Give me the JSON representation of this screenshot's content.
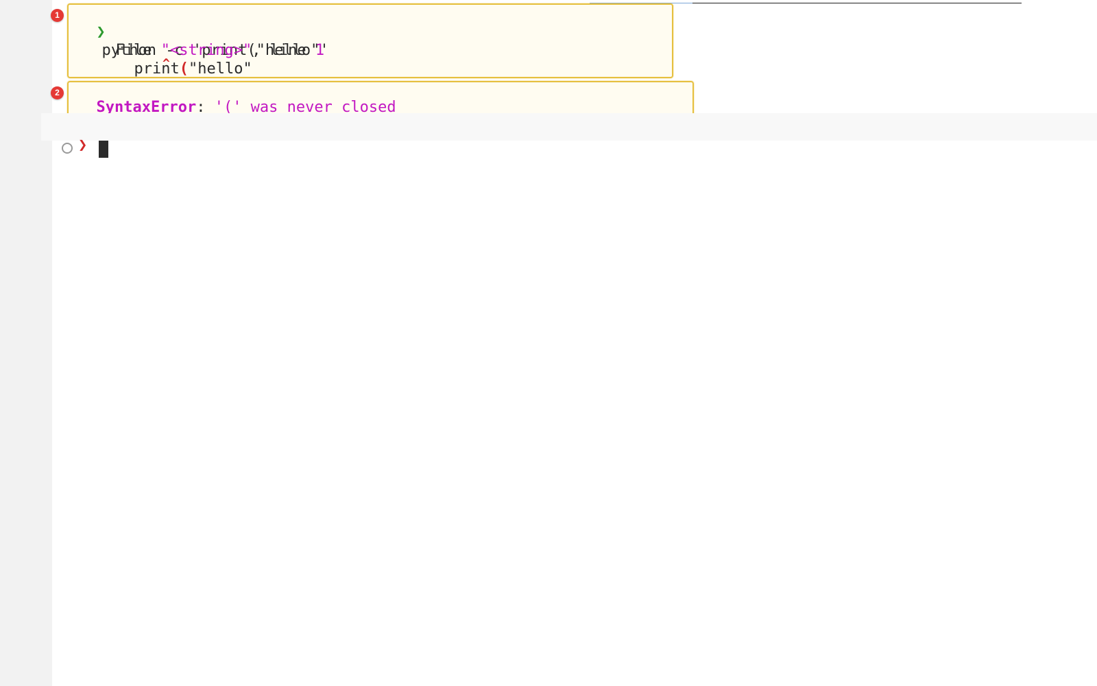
{
  "terminal": {
    "history": [
      {
        "prompt_glyph": "❯",
        "command": "python -c 'print(\"hello\"'",
        "traceback": {
          "file_prefix": "File ",
          "file_name": "\"<string>\"",
          "line_text": ", line ",
          "line_number": "1",
          "code_indent": "    ",
          "code_before": "print",
          "code_paren": "(",
          "code_after": "\"hello\"",
          "caret": "^"
        },
        "error": {
          "type": "SyntaxError",
          "separator": ": ",
          "message": "'(' was never closed"
        }
      }
    ],
    "current_prompt_glyph": "❯",
    "annotations": [
      {
        "label": "1"
      },
      {
        "label": "2"
      }
    ]
  },
  "colors": {
    "prompt_success": "#2e9a2e",
    "prompt_error": "#d12a2a",
    "magenta": "#c218c2",
    "highlight_border": "#e6c040"
  }
}
